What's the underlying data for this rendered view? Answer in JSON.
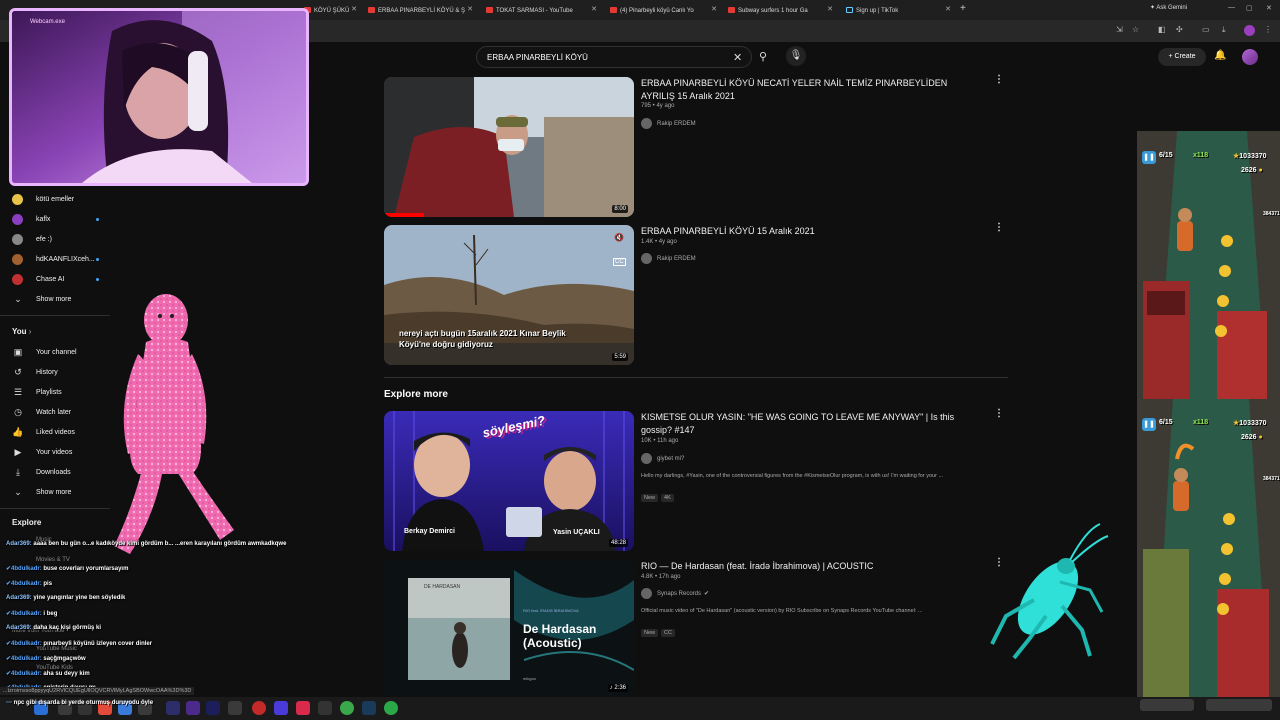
{
  "browser": {
    "tabs": [
      {
        "label": "KÖYÜ ŞÜKÜ"
      },
      {
        "label": "ERBAA PINARBEYLİ KÖYÜ & Ş"
      },
      {
        "label": "TOKAT SARMASI - YouTube"
      },
      {
        "label": "(4) Pinarbeyli köyü Canlı Yo"
      },
      {
        "label": "Subway surfers 1 hour Ga"
      },
      {
        "label": "Sign up | TikTok"
      }
    ],
    "ask_gemini": "Ask Gemini",
    "status_url": "...tzroirnsso8ppyyqU2RVlCQUEgUllOQVCRVlMyLAgSBOWwcOAA%3D%3D"
  },
  "webcam": {
    "label": "Webcam.exe"
  },
  "search": {
    "query": "ERBAA PINARBEYLİ KÖYÜ"
  },
  "header": {
    "create_label": "Create"
  },
  "sidebar": {
    "subscriptions": [
      {
        "label": "kötü emeller",
        "color": "#e8c34a",
        "dot": false
      },
      {
        "label": "kaflx",
        "color": "#8a3fc0",
        "dot": true
      },
      {
        "label": "efe :)",
        "color": "#888888",
        "dot": false
      },
      {
        "label": "hdKAANFLIXceh...",
        "color": "#a06030",
        "dot": true
      },
      {
        "label": "Chase AI",
        "color": "#c03030",
        "dot": true
      }
    ],
    "show_more_1": "Show more",
    "you_label": "You",
    "you_items": [
      {
        "label": "Your channel",
        "icon": "channel-icon",
        "glyph": "▣"
      },
      {
        "label": "History",
        "icon": "history-icon",
        "glyph": "↺"
      },
      {
        "label": "Playlists",
        "icon": "playlists-icon",
        "glyph": "☰"
      },
      {
        "label": "Watch later",
        "icon": "clock-icon",
        "glyph": "◷"
      },
      {
        "label": "Liked videos",
        "icon": "thumbs-up-icon",
        "glyph": "👍"
      },
      {
        "label": "Your videos",
        "icon": "video-icon",
        "glyph": "▶"
      },
      {
        "label": "Downloads",
        "icon": "download-icon",
        "glyph": "⤓"
      }
    ],
    "show_more_2": "Show more",
    "explore_label": "Explore",
    "explore_ghost": [
      "Music",
      "Movies & TV"
    ],
    "more_ghost": [
      "More from YouTube",
      "YouTube Music",
      "YouTube Kids"
    ]
  },
  "chat": [
    {
      "user": "Adar369:",
      "text": "aaaa ben bu gün o...e kadıköyde kimi gördüm b... ...eren karayılanı gördüm awmkadkqwe"
    },
    {
      "user": "4bdulkadr:",
      "text": "buse coverları yorumlarsayım"
    },
    {
      "user": "4bdulkadr:",
      "text": "pis"
    },
    {
      "user": "Adar369:",
      "text": "yine yangınlar yine ben söyledik"
    },
    {
      "user": "4bdulkadr:",
      "text": "i beg"
    },
    {
      "user": "Adar369:",
      "text": "daha kaç kişi görmüş ki"
    },
    {
      "user": "4bdulkadr:",
      "text": "pınarbeyli köyünü izleyen cover dinler"
    },
    {
      "user": "4bdulkadr:",
      "text": "saçğmgaçwöw"
    },
    {
      "user": "4bdulkadr:",
      "text": "aha su deyy kim"
    },
    {
      "user": "4bdulkadr:",
      "text": "enişterin dayısı mı"
    }
  ],
  "bottom_chat": "npc gibi dışarda bi yerde oturmuş duruyodu öyle",
  "results": [
    {
      "title": "ERBAA PINARBEYLİ KÖYÜ NECATİ YELER NAİL TEMİZ PINARBEYLİDEN AYRILIŞ 15 Aralık 2021",
      "meta": "795 • 4y ago",
      "channel": "Rakip ERDEM",
      "duration": "8:00"
    },
    {
      "title": "ERBAA PINARBEYLİ KÖYÜ 15 Aralık 2021",
      "meta": "1.4K • 4y ago",
      "channel": "Rakip ERDEM",
      "duration": "5:59",
      "overlay_caption": "nereyi açtı bugün 15aralık 2021 Kınar Beylik Köyü'ne doğru gidiyoruz"
    }
  ],
  "explore_more": {
    "heading": "Explore more",
    "items": [
      {
        "title": "KISMETSE OLUR YASIN: \"HE WAS GOING TO LEAVE ME ANYWAY\" | Is this gossip? #147",
        "meta": "10K • 11h ago",
        "channel": "giybet mi?",
        "desc": "Hello my darlings, #Yasin, one of the controversial figures from the #KismetseOlur program, is with us! I'm waiting for your ...",
        "badges": [
          "New",
          "4K"
        ],
        "duration": "48:28",
        "thumb_text": {
          "left_name": "Berkay Demirci",
          "right_name": "Yasin UÇAKLI",
          "logo": "söyleşmi?"
        }
      },
      {
        "title": "RIO — De Hardasan (feat. İradə İbrahimova) | ACOUSTIC",
        "meta": "4.8K • 17h ago",
        "channel": "Synaps Records",
        "desc": "Official music video of \"De Hardasan\" (acoustic version) by RIO Subscribe on Synaps Records YouTube channel: ...",
        "badges": [
          "New",
          "CC"
        ],
        "duration": "2:36",
        "thumb_text": {
          "title": "De Hardasan (Acoustic)",
          "small": "RIO feat. İRADƏ İBRAHİMOVA",
          "album": "DE HARDASAN",
          "brand": "mikgoo"
        }
      }
    ]
  },
  "game": {
    "top": {
      "progress": "6/15",
      "multiplier": "x118",
      "score": "1033370",
      "coins": "2626",
      "extra": "384371"
    },
    "bottom": {
      "progress": "6/15",
      "multiplier": "x118",
      "score": "1033370",
      "coins": "2626",
      "extra": "384371"
    }
  },
  "colors": {
    "accent": "#3ea6ff",
    "webcam_border": "#e9b5ff",
    "pink_figure": "#f06ab0",
    "roach": "#2fe0d8"
  }
}
